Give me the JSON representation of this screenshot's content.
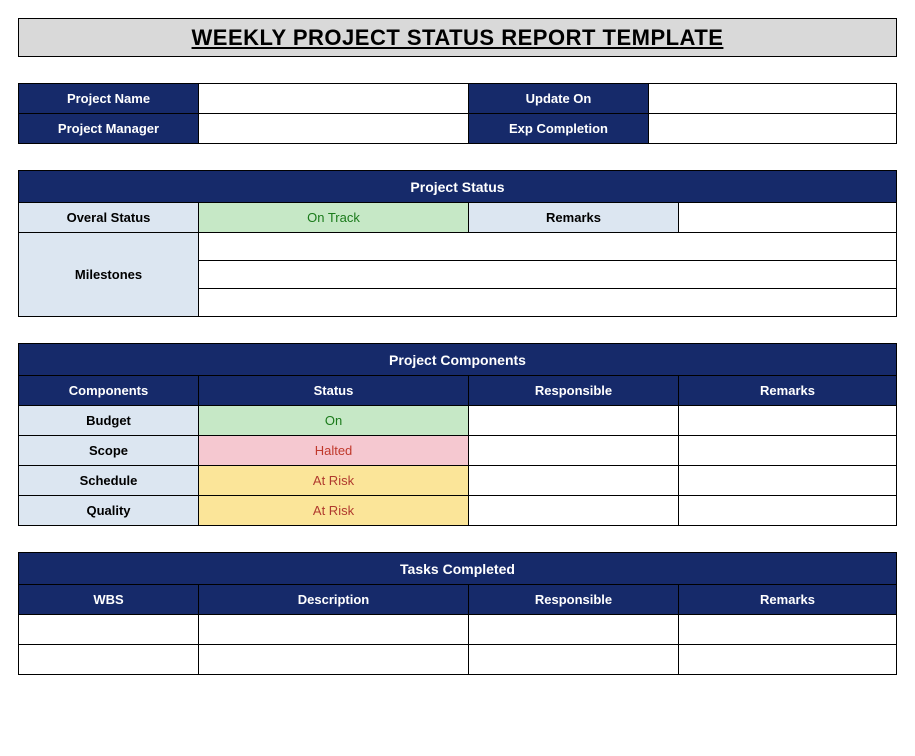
{
  "title": "WEEKLY PROJECT STATUS REPORT TEMPLATE",
  "info": {
    "project_name_label": "Project Name",
    "project_name_value": "",
    "update_on_label": "Update On",
    "update_on_value": "",
    "project_manager_label": "Project Manager",
    "project_manager_value": "",
    "exp_completion_label": "Exp Completion",
    "exp_completion_value": ""
  },
  "project_status": {
    "header": "Project Status",
    "overall_status_label": "Overal Status",
    "overall_status_value": "On Track",
    "remarks_label": "Remarks",
    "remarks_value": "",
    "milestones_label": "Milestones",
    "milestone_1": "",
    "milestone_2": "",
    "milestone_3": ""
  },
  "components": {
    "header": "Project Components",
    "col_components": "Components",
    "col_status": "Status",
    "col_responsible": "Responsible",
    "col_remarks": "Remarks",
    "rows": [
      {
        "name": "Budget",
        "status": "On",
        "status_class": "green",
        "responsible": "",
        "remarks": ""
      },
      {
        "name": "Scope",
        "status": "Halted",
        "status_class": "red",
        "responsible": "",
        "remarks": ""
      },
      {
        "name": "Schedule",
        "status": "At Risk",
        "status_class": "yellow",
        "responsible": "",
        "remarks": ""
      },
      {
        "name": "Quality",
        "status": "At Risk",
        "status_class": "yellow",
        "responsible": "",
        "remarks": ""
      }
    ]
  },
  "tasks": {
    "header": "Tasks Completed",
    "col_wbs": "WBS",
    "col_description": "Description",
    "col_responsible": "Responsible",
    "col_remarks": "Remarks",
    "rows": [
      {
        "wbs": "",
        "description": "",
        "responsible": "",
        "remarks": ""
      },
      {
        "wbs": "",
        "description": "",
        "responsible": "",
        "remarks": ""
      }
    ]
  }
}
